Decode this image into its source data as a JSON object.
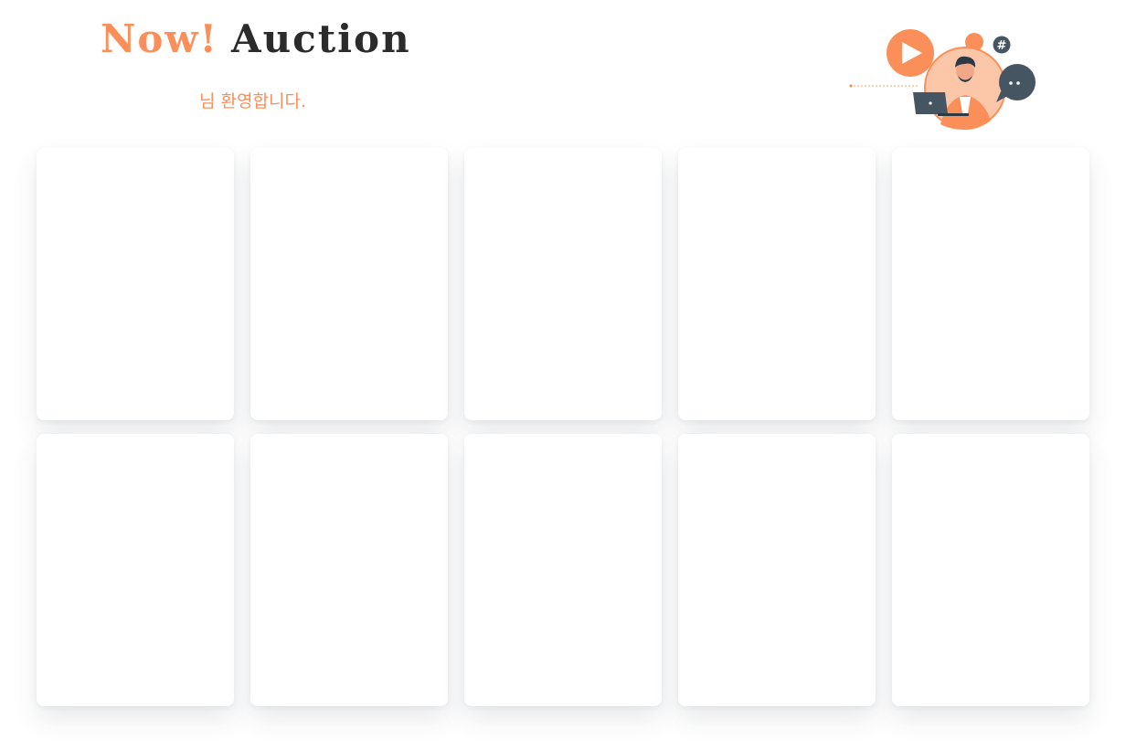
{
  "header": {
    "logo_now": "Now!",
    "logo_auction": "Auction",
    "welcome_text": "님 환영합니다."
  },
  "illustration": {
    "icons": [
      "play-icon",
      "hashtag-icon",
      "chat-bubble-icon",
      "laptop-icon",
      "person-avatar"
    ],
    "hashtag_symbol": "#"
  },
  "colors": {
    "accent": "#fb8f5a",
    "dark": "#2b2b2b",
    "slate": "#455561",
    "peach": "#fbc7a8",
    "background": "#ffffff"
  },
  "auction_cards": [
    {},
    {},
    {},
    {},
    {},
    {},
    {},
    {},
    {},
    {}
  ]
}
